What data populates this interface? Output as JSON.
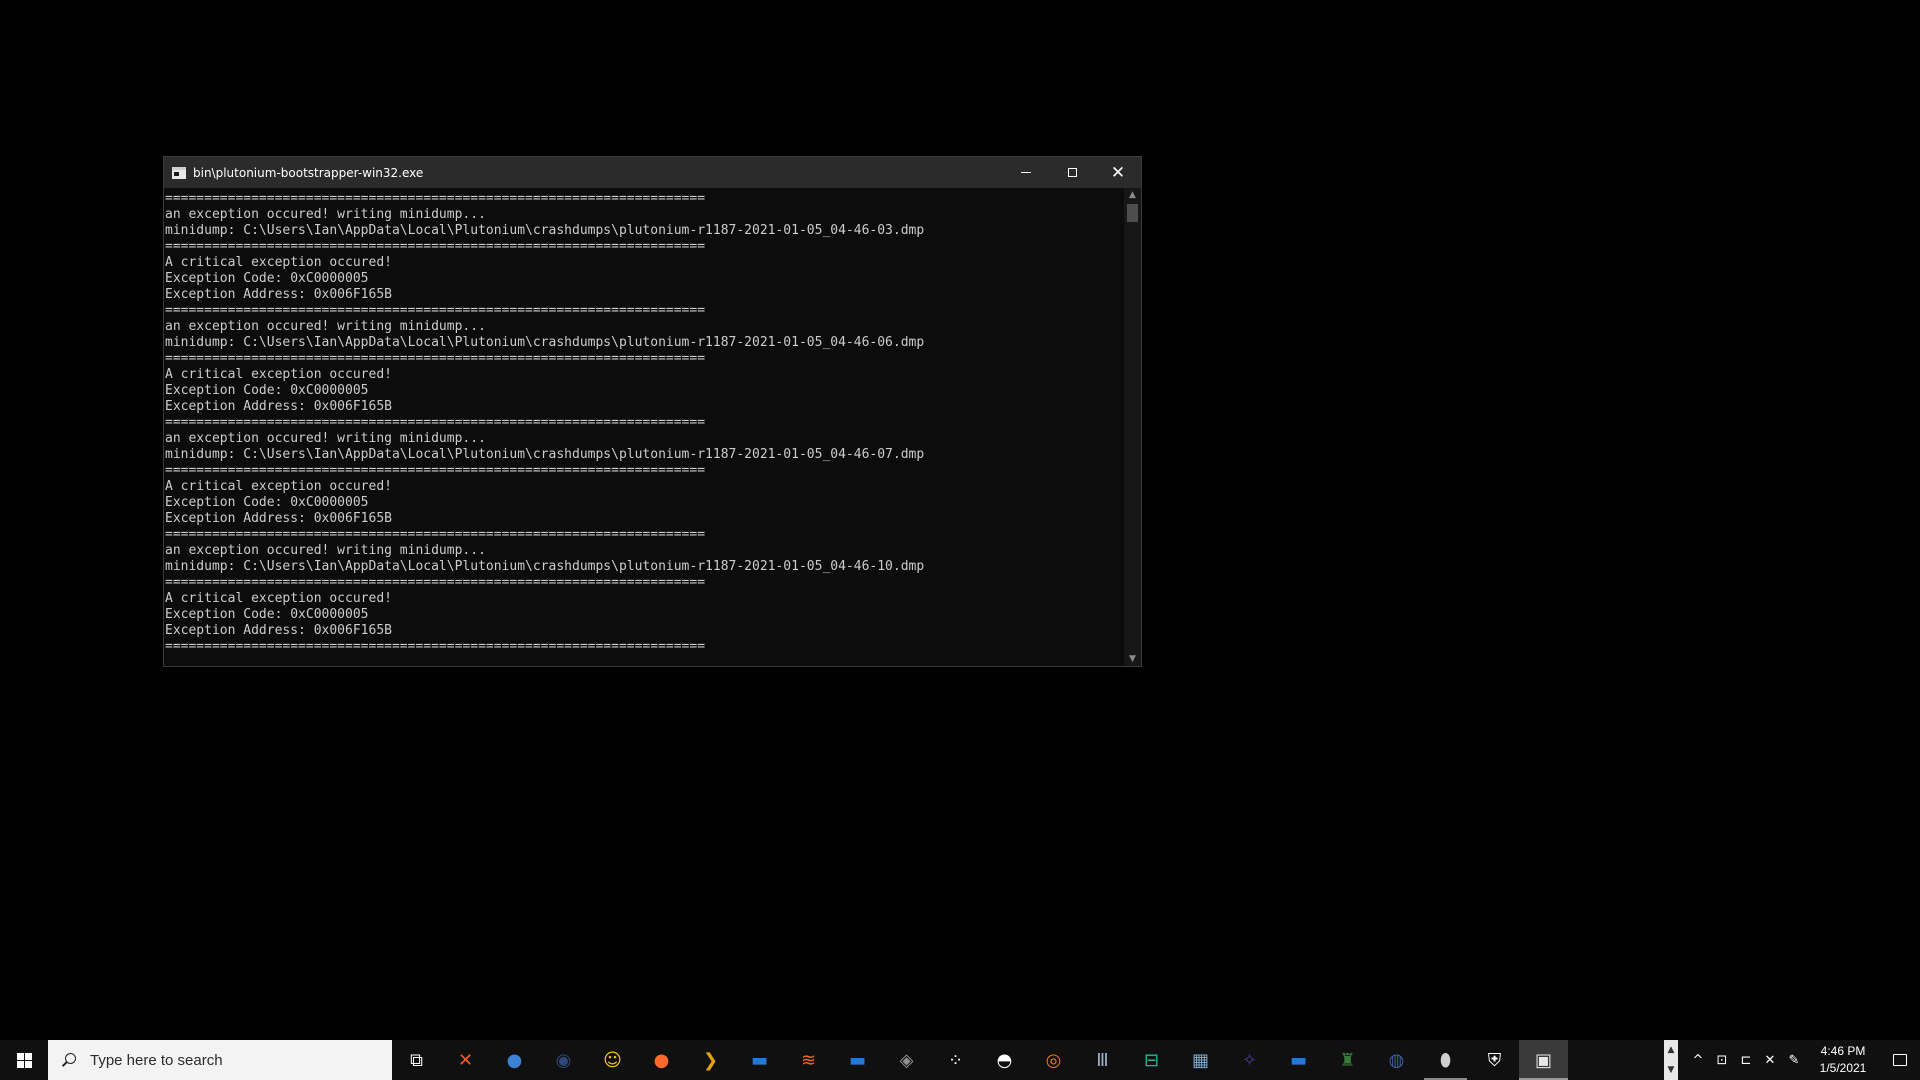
{
  "window": {
    "title": "bin\\plutonium-bootstrapper-win32.exe",
    "controls": {
      "minimize": "─",
      "maximize": "☐",
      "close": "✕"
    }
  },
  "console": {
    "lines": [
      "=====================================================================",
      "an exception occured! writing minidump...",
      "minidump: C:\\Users\\Ian\\AppData\\Local\\Plutonium\\crashdumps\\plutonium-r1187-2021-01-05_04-46-03.dmp",
      "=====================================================================",
      "A critical exception occured!",
      "Exception Code: 0xC0000005",
      "Exception Address: 0x006F165B",
      "=====================================================================",
      "an exception occured! writing minidump...",
      "minidump: C:\\Users\\Ian\\AppData\\Local\\Plutonium\\crashdumps\\plutonium-r1187-2021-01-05_04-46-06.dmp",
      "=====================================================================",
      "A critical exception occured!",
      "Exception Code: 0xC0000005",
      "Exception Address: 0x006F165B",
      "=====================================================================",
      "an exception occured! writing minidump...",
      "minidump: C:\\Users\\Ian\\AppData\\Local\\Plutonium\\crashdumps\\plutonium-r1187-2021-01-05_04-46-07.dmp",
      "=====================================================================",
      "A critical exception occured!",
      "Exception Code: 0xC0000005",
      "Exception Address: 0x006F165B",
      "=====================================================================",
      "an exception occured! writing minidump...",
      "minidump: C:\\Users\\Ian\\AppData\\Local\\Plutonium\\crashdumps\\plutonium-r1187-2021-01-05_04-46-10.dmp",
      "=====================================================================",
      "A critical exception occured!",
      "Exception Code: 0xC0000005",
      "Exception Address: 0x006F165B",
      "====================================================================="
    ]
  },
  "taskbar": {
    "search_placeholder": "Type here to search",
    "icons": [
      {
        "name": "task-view-icon",
        "color": "#ffffff",
        "glyph": "⧉",
        "running": false
      },
      {
        "name": "origin-dev-icon",
        "color": "#f25a22",
        "glyph": "✕",
        "running": false
      },
      {
        "name": "chrome-canary-icon",
        "color": "#3b82d6",
        "glyph": "●",
        "running": false
      },
      {
        "name": "steam-icon",
        "color": "#2b4a78",
        "glyph": "◉",
        "running": false
      },
      {
        "name": "norton-icon",
        "color": "#f5c518",
        "glyph": "☺",
        "running": false
      },
      {
        "name": "firefox-icon",
        "color": "#ff6a2c",
        "glyph": "●",
        "running": false
      },
      {
        "name": "plex-icon",
        "color": "#e5a00d",
        "glyph": "❯",
        "running": false
      },
      {
        "name": "file-explorer-icon",
        "color": "#1f7ae0",
        "glyph": "▬",
        "running": false
      },
      {
        "name": "orange-app-icon",
        "color": "#f26a21",
        "glyph": "≋",
        "running": false
      },
      {
        "name": "windows-store-icon",
        "color": "#1f7ae0",
        "glyph": "▬",
        "running": false
      },
      {
        "name": "virtualbox-icon",
        "color": "#8f8f8f",
        "glyph": "◈",
        "running": false
      },
      {
        "name": "dots-app-icon",
        "color": "#ffffff",
        "glyph": "⁘",
        "running": false
      },
      {
        "name": "discord-like-icon",
        "color": "#ffffff",
        "glyph": "◓",
        "running": false
      },
      {
        "name": "blender-icon",
        "color": "#e87d0d",
        "glyph": "◎",
        "running": false
      },
      {
        "name": "equalizer-icon",
        "color": "#9ab0c8",
        "glyph": "Ⅲ",
        "running": false
      },
      {
        "name": "gamepad-app-icon",
        "color": "#2bb596",
        "glyph": "⊟",
        "running": false
      },
      {
        "name": "network-app-icon",
        "color": "#7fa7c9",
        "glyph": "▦",
        "running": false
      },
      {
        "name": "purple-app-icon",
        "color": "#4a3a8c",
        "glyph": "✧",
        "running": false
      },
      {
        "name": "explorer-window-icon",
        "color": "#1f7ae0",
        "glyph": "▬",
        "running": false
      },
      {
        "name": "character-app-icon",
        "color": "#3c7a3c",
        "glyph": "♜",
        "running": false
      },
      {
        "name": "globe-app-icon",
        "color": "#3f5f9f",
        "glyph": "◍",
        "running": false
      },
      {
        "name": "egg-app-icon",
        "color": "#cfcfcf",
        "glyph": "⬮",
        "running": true
      },
      {
        "name": "shield-app-icon",
        "color": "#ffffff",
        "glyph": "⛨",
        "running": false
      },
      {
        "name": "console-window-icon",
        "color": "#e8e8e8",
        "glyph": "▣",
        "running": true,
        "active": true
      }
    ]
  },
  "tray": {
    "chevron": "^",
    "icons": [
      {
        "name": "meet-now-icon",
        "glyph": "⊡"
      },
      {
        "name": "network-icon",
        "glyph": "⊏"
      },
      {
        "name": "volume-muted-icon",
        "glyph": "✕"
      },
      {
        "name": "pen-icon",
        "glyph": "✎"
      }
    ],
    "time": "4:46 PM",
    "date": "1/5/2021"
  }
}
